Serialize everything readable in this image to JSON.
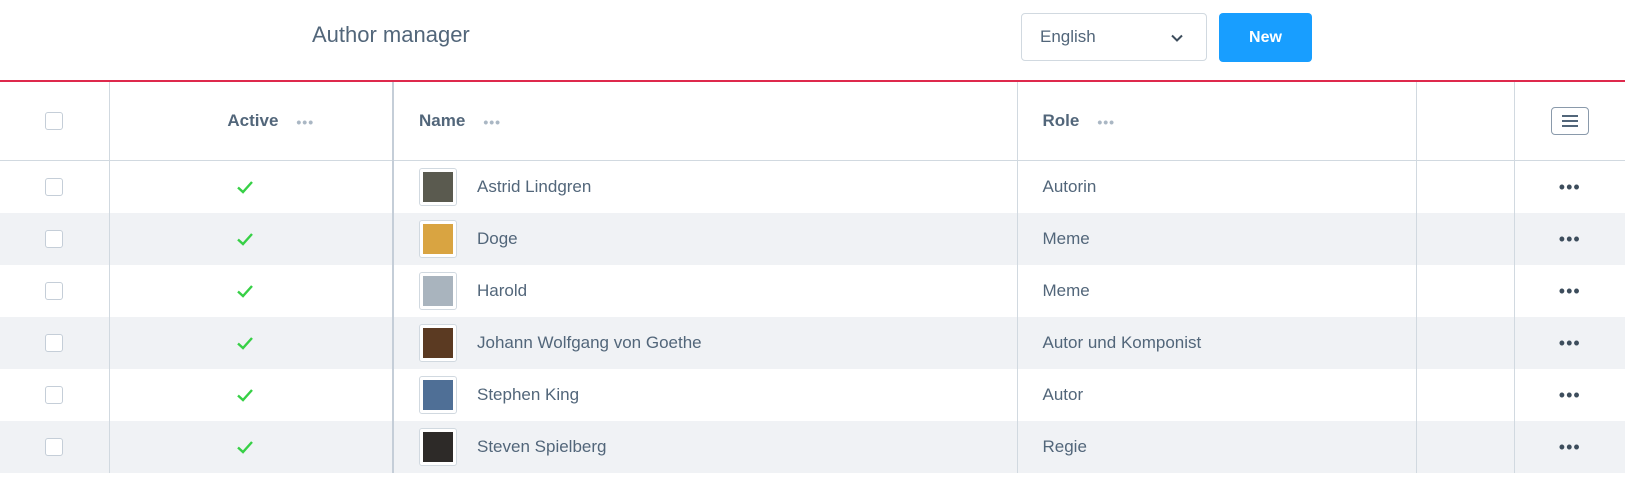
{
  "header": {
    "title": "Author manager",
    "language": {
      "selected": "English",
      "icon": "chevron-down-icon"
    },
    "new_label": "New"
  },
  "table": {
    "columns": {
      "active": "Active",
      "name": "Name",
      "role": "Role",
      "more_icon": "ellipsis-icon",
      "settings_icon": "hamburger-menu-icon"
    },
    "rows": [
      {
        "active": true,
        "name": "Astrid Lindgren",
        "role": "Autorin",
        "avatar_color": "#5a5a4f"
      },
      {
        "active": true,
        "name": "Doge",
        "role": "Meme",
        "avatar_color": "#d9a441"
      },
      {
        "active": true,
        "name": "Harold",
        "role": "Meme",
        "avatar_color": "#a9b4be"
      },
      {
        "active": true,
        "name": "Johann Wolfgang von Goethe",
        "role": "Autor und Komponist",
        "avatar_color": "#5b3a22"
      },
      {
        "active": true,
        "name": "Stephen King",
        "role": "Autor",
        "avatar_color": "#4f6f96"
      },
      {
        "active": true,
        "name": "Steven Spielberg",
        "role": "Regie",
        "avatar_color": "#2d2a28"
      }
    ]
  },
  "colors": {
    "primary": "#189eff",
    "accent_line": "#de294c",
    "check": "#37d046",
    "text": "#52667a"
  }
}
